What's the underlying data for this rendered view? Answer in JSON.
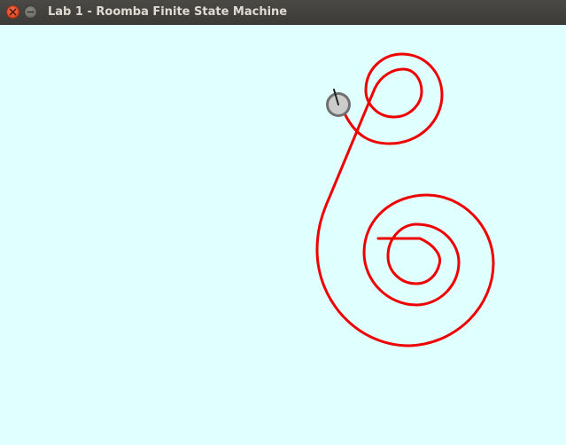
{
  "window": {
    "title": "Lab 1 - Roomba Finite State Machine",
    "controls": [
      {
        "name": "close",
        "icon": "close-icon"
      },
      {
        "name": "minimize",
        "icon": "minimize-icon"
      }
    ]
  },
  "colors": {
    "background": "#e0ffff",
    "path": "#ee0000",
    "robot_fill": "#cccccc",
    "robot_outline": "#707070",
    "heading": "#222222",
    "titlebar": "#3c3b37",
    "close_button": "#e1471f"
  },
  "scene": {
    "robot": {
      "icon": "roomba-icon"
    },
    "path": {
      "icon": "trajectory-path"
    }
  }
}
